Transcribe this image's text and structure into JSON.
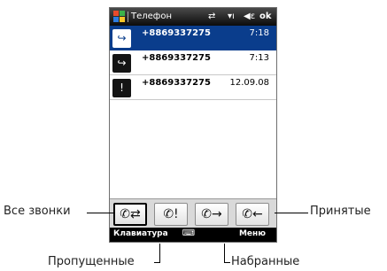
{
  "titlebar": {
    "app_title": "Телефон",
    "ok": "ok",
    "icons": [
      "windows-logo",
      "sync-icon",
      "signal-icon",
      "volume-icon"
    ]
  },
  "calls": [
    {
      "number": "+8869337275",
      "time": "7:18",
      "type": "outgoing",
      "icon": "↪",
      "selected": true
    },
    {
      "number": "+8869337275",
      "time": "7:13",
      "type": "outgoing",
      "icon": "↪",
      "selected": false
    },
    {
      "number": "+8869337275",
      "time": "12.09.08",
      "type": "missed",
      "icon": "!",
      "selected": false
    }
  ],
  "tabs": [
    {
      "id": "all",
      "glyph": "✆⇄",
      "active": true
    },
    {
      "id": "missed",
      "glyph": "✆!",
      "active": false
    },
    {
      "id": "dialed",
      "glyph": "✆→",
      "active": false
    },
    {
      "id": "received",
      "glyph": "✆←",
      "active": false
    }
  ],
  "softkeys": {
    "left": "Клавиатура",
    "right": "Меню",
    "keyboard_icon": "⌨"
  },
  "callouts": {
    "all_calls": "Все звонки",
    "received": "Принятые",
    "missed": "Пропущенные",
    "dialed": "Набранные"
  },
  "colors": {
    "selection": "#0a3d8c",
    "titlebar": "#1a1a1a"
  }
}
